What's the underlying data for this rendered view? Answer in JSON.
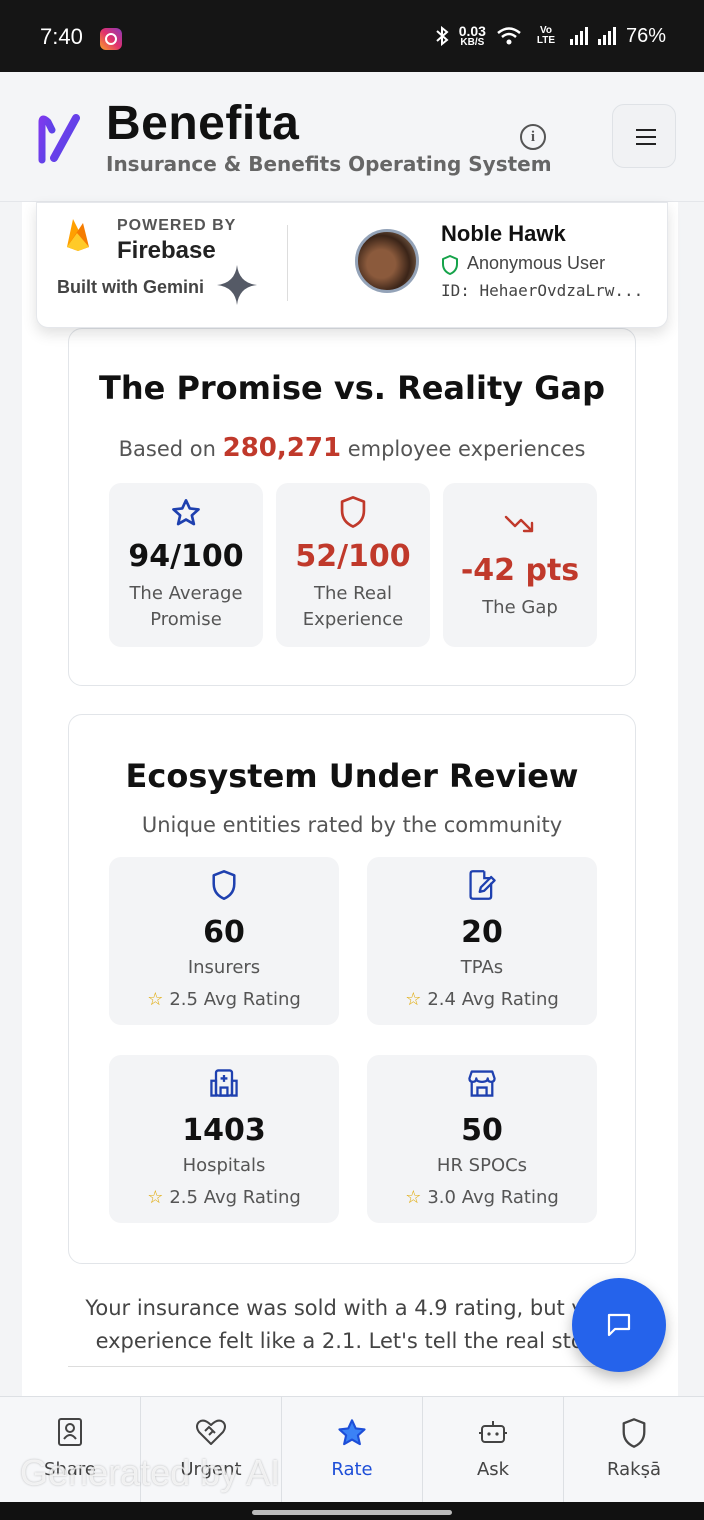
{
  "status_bar": {
    "time": "7:40",
    "net_speed_value": "0.03",
    "net_speed_unit": "KB/S",
    "volte": "Vo LTE",
    "battery": "76%"
  },
  "header": {
    "brand": "Benefita",
    "tagline": "Insurance & Benefits Operating System"
  },
  "firebase_popup": {
    "powered_by": "POWERED BY",
    "firebase": "Firebase",
    "built_with": "Built with Gemini",
    "user_name": "Noble Hawk",
    "user_role": "Anonymous User",
    "user_id": "ID: HehaerOvdzaLrw..."
  },
  "gap_card": {
    "title": "The Promise vs. Reality Gap",
    "subtitle_prefix": "Based on",
    "count": "280,271",
    "subtitle_suffix": "employee experiences",
    "tiles": [
      {
        "value": "94/100",
        "label_line1": "The Average",
        "label_line2": "Promise",
        "icon": "star-icon",
        "color": "#1e40af"
      },
      {
        "value": "52/100",
        "label_line1": "The Real",
        "label_line2": "Experience",
        "icon": "shield-icon",
        "color": "#c0392b"
      },
      {
        "value": "-42 pts",
        "label_line1": "The Gap",
        "label_line2": "",
        "icon": "trending-down-icon",
        "color": "#c0392b"
      }
    ]
  },
  "eco_card": {
    "title": "Ecosystem Under Review",
    "subtitle": "Unique entities rated by the community",
    "tiles": [
      {
        "value": "60",
        "label": "Insurers",
        "rating": "2.5 Avg Rating",
        "icon": "shield-icon"
      },
      {
        "value": "20",
        "label": "TPAs",
        "rating": "2.4 Avg Rating",
        "icon": "document-edit-icon"
      },
      {
        "value": "1403",
        "label": "Hospitals",
        "rating": "2.5 Avg Rating",
        "icon": "hospital-icon"
      },
      {
        "value": "50",
        "label": "HR SPOCs",
        "rating": "3.0 Avg Rating",
        "icon": "store-icon"
      }
    ]
  },
  "bottom_text": {
    "line1": "Your insurance was sold with a 4.9 rating, but your",
    "line2": "experience felt like a 2.1. Let's tell the real story."
  },
  "tabs": [
    {
      "label": "Share",
      "icon": "contact-card-icon"
    },
    {
      "label": "Urgent",
      "icon": "heart-handshake-icon"
    },
    {
      "label": "Rate",
      "icon": "star-icon",
      "active": true
    },
    {
      "label": "Ask",
      "icon": "bot-icon"
    },
    {
      "label": "Rakṣā",
      "icon": "shield-icon"
    }
  ],
  "watermark": "Generated by AI",
  "colors": {
    "accent": "#2563eb",
    "danger": "#c0392b",
    "star": "#e0a800"
  }
}
